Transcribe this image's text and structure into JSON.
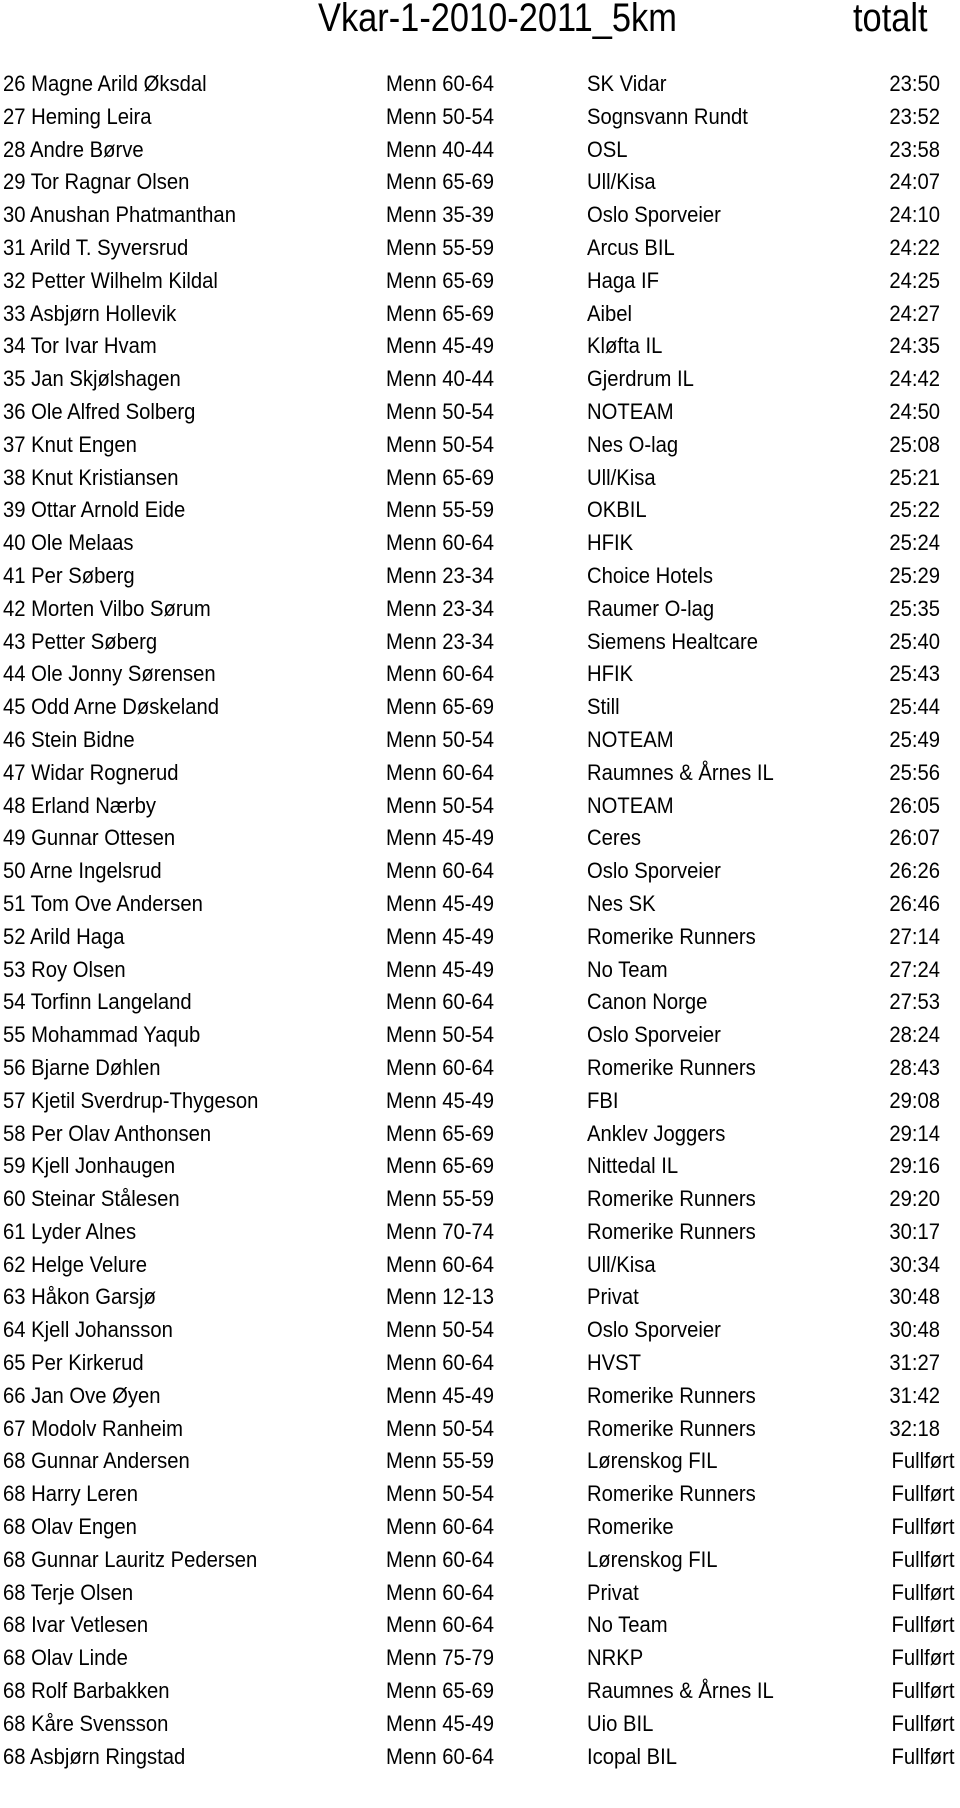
{
  "document": {
    "title": "Vkar-1-2010-2011_5km",
    "title_suffix": "totalt"
  },
  "results": [
    {
      "place": "26",
      "name": "Magne Arild Øksdal",
      "class": "Menn 60-64",
      "club": "SK Vidar",
      "time": "23:50"
    },
    {
      "place": "27",
      "name": "Heming Leira",
      "class": "Menn 50-54",
      "club": "Sognsvann Rundt",
      "time": "23:52"
    },
    {
      "place": "28",
      "name": "Andre Børve",
      "class": "Menn 40-44",
      "club": "OSL",
      "time": "23:58"
    },
    {
      "place": "29",
      "name": "Tor Ragnar Olsen",
      "class": "Menn 65-69",
      "club": "Ull/Kisa",
      "time": "24:07"
    },
    {
      "place": "30",
      "name": "Anushan Phatmanthan",
      "class": "Menn 35-39",
      "club": "Oslo Sporveier",
      "time": "24:10"
    },
    {
      "place": "31",
      "name": "Arild T. Syversrud",
      "class": "Menn 55-59",
      "club": "Arcus BIL",
      "time": "24:22"
    },
    {
      "place": "32",
      "name": "Petter Wilhelm Kildal",
      "class": "Menn 65-69",
      "club": "Haga IF",
      "time": "24:25"
    },
    {
      "place": "33",
      "name": "Asbjørn Hollevik",
      "class": "Menn 65-69",
      "club": "Aibel",
      "time": "24:27"
    },
    {
      "place": "34",
      "name": "Tor Ivar Hvam",
      "class": "Menn 45-49",
      "club": "Kløfta IL",
      "time": "24:35"
    },
    {
      "place": "35",
      "name": "Jan Skjølshagen",
      "class": "Menn 40-44",
      "club": "Gjerdrum IL",
      "time": "24:42"
    },
    {
      "place": "36",
      "name": "Ole Alfred Solberg",
      "class": "Menn 50-54",
      "club": "NOTEAM",
      "time": "24:50"
    },
    {
      "place": "37",
      "name": "Knut Engen",
      "class": "Menn 50-54",
      "club": "Nes O-lag",
      "time": "25:08"
    },
    {
      "place": "38",
      "name": "Knut Kristiansen",
      "class": "Menn 65-69",
      "club": "Ull/Kisa",
      "time": "25:21"
    },
    {
      "place": "39",
      "name": "Ottar Arnold Eide",
      "class": "Menn 55-59",
      "club": "OKBIL",
      "time": "25:22"
    },
    {
      "place": "40",
      "name": "Ole Melaas",
      "class": "Menn 60-64",
      "club": "HFIK",
      "time": "25:24"
    },
    {
      "place": "41",
      "name": "Per Søberg",
      "class": "Menn 23-34",
      "club": "Choice Hotels",
      "time": "25:29"
    },
    {
      "place": "42",
      "name": "Morten Vilbo Sørum",
      "class": "Menn 23-34",
      "club": "Raumer O-lag",
      "time": "25:35"
    },
    {
      "place": "43",
      "name": "Petter Søberg",
      "class": "Menn 23-34",
      "club": "Siemens Healtcare",
      "time": "25:40"
    },
    {
      "place": "44",
      "name": "Ole Jonny Sørensen",
      "class": "Menn 60-64",
      "club": "HFIK",
      "time": "25:43"
    },
    {
      "place": "45",
      "name": "Odd Arne Døskeland",
      "class": "Menn 65-69",
      "club": "Still",
      "time": "25:44"
    },
    {
      "place": "46",
      "name": "Stein Bidne",
      "class": "Menn 50-54",
      "club": "NOTEAM",
      "time": "25:49"
    },
    {
      "place": "47",
      "name": "Widar Rognerud",
      "class": "Menn 60-64",
      "club": "Raumnes & Årnes IL",
      "time": "25:56"
    },
    {
      "place": "48",
      "name": "Erland Nærby",
      "class": "Menn 50-54",
      "club": "NOTEAM",
      "time": "26:05"
    },
    {
      "place": "49",
      "name": "Gunnar Ottesen",
      "class": "Menn 45-49",
      "club": "Ceres",
      "time": "26:07"
    },
    {
      "place": "50",
      "name": "Arne Ingelsrud",
      "class": "Menn 60-64",
      "club": "Oslo Sporveier",
      "time": "26:26"
    },
    {
      "place": "51",
      "name": "Tom Ove Andersen",
      "class": "Menn 45-49",
      "club": "Nes SK",
      "time": "26:46"
    },
    {
      "place": "52",
      "name": "Arild Haga",
      "class": "Menn 45-49",
      "club": "Romerike Runners",
      "time": "27:14"
    },
    {
      "place": "53",
      "name": "Roy Olsen",
      "class": "Menn 45-49",
      "club": "No Team",
      "time": "27:24"
    },
    {
      "place": "54",
      "name": "Torfinn Langeland",
      "class": "Menn 60-64",
      "club": "Canon Norge",
      "time": "27:53"
    },
    {
      "place": "55",
      "name": "Mohammad Yaqub",
      "class": "Menn 50-54",
      "club": "Oslo Sporveier",
      "time": "28:24"
    },
    {
      "place": "56",
      "name": "Bjarne Døhlen",
      "class": "Menn 60-64",
      "club": "Romerike Runners",
      "time": "28:43"
    },
    {
      "place": "57",
      "name": "Kjetil Sverdrup-Thygeson",
      "class": "Menn 45-49",
      "club": "FBI",
      "time": "29:08"
    },
    {
      "place": "58",
      "name": "Per Olav Anthonsen",
      "class": "Menn 65-69",
      "club": "Anklev Joggers",
      "time": "29:14"
    },
    {
      "place": "59",
      "name": "Kjell Jonhaugen",
      "class": "Menn 65-69",
      "club": "Nittedal IL",
      "time": "29:16"
    },
    {
      "place": "60",
      "name": "Steinar Stålesen",
      "class": "Menn 55-59",
      "club": "Romerike Runners",
      "time": "29:20"
    },
    {
      "place": "61",
      "name": "Lyder Alnes",
      "class": "Menn 70-74",
      "club": "Romerike Runners",
      "time": "30:17"
    },
    {
      "place": "62",
      "name": "Helge Velure",
      "class": "Menn 60-64",
      "club": "Ull/Kisa",
      "time": "30:34"
    },
    {
      "place": "63",
      "name": "Håkon Garsjø",
      "class": "Menn 12-13",
      "club": "Privat",
      "time": "30:48"
    },
    {
      "place": "64",
      "name": "Kjell Johansson",
      "class": "Menn 50-54",
      "club": "Oslo Sporveier",
      "time": "30:48"
    },
    {
      "place": "65",
      "name": "Per Kirkerud",
      "class": "Menn 60-64",
      "club": "HVST",
      "time": "31:27"
    },
    {
      "place": "66",
      "name": "Jan Ove Øyen",
      "class": "Menn 45-49",
      "club": "Romerike Runners",
      "time": "31:42"
    },
    {
      "place": "67",
      "name": "Modolv Ranheim",
      "class": "Menn 50-54",
      "club": "Romerike Runners",
      "time": "32:18"
    },
    {
      "place": "68",
      "name": "Gunnar Andersen",
      "class": "Menn 55-59",
      "club": "Lørenskog FIL",
      "time": "Fullført"
    },
    {
      "place": "68",
      "name": "Harry Leren",
      "class": "Menn 50-54",
      "club": "Romerike Runners",
      "time": "Fullført"
    },
    {
      "place": "68",
      "name": "Olav Engen",
      "class": "Menn 60-64",
      "club": "Romerike",
      "time": "Fullført"
    },
    {
      "place": "68",
      "name": "Gunnar Lauritz Pedersen",
      "class": "Menn 60-64",
      "club": "Lørenskog FIL",
      "time": "Fullført"
    },
    {
      "place": "68",
      "name": "Terje Olsen",
      "class": "Menn 60-64",
      "club": "Privat",
      "time": "Fullført"
    },
    {
      "place": "68",
      "name": "Ivar Vetlesen",
      "class": "Menn 60-64",
      "club": "No Team",
      "time": "Fullført"
    },
    {
      "place": "68",
      "name": "Olav Linde",
      "class": "Menn 75-79",
      "club": "NRKP",
      "time": "Fullført"
    },
    {
      "place": "68",
      "name": "Rolf Barbakken",
      "class": "Menn 65-69",
      "club": "Raumnes & Årnes IL",
      "time": "Fullført"
    },
    {
      "place": "68",
      "name": "Kåre Svensson",
      "class": "Menn 45-49",
      "club": "Uio BIL",
      "time": "Fullført"
    },
    {
      "place": "68",
      "name": "Asbjørn Ringstad",
      "class": "Menn 60-64",
      "club": "Icopal BIL",
      "time": "Fullført"
    }
  ]
}
